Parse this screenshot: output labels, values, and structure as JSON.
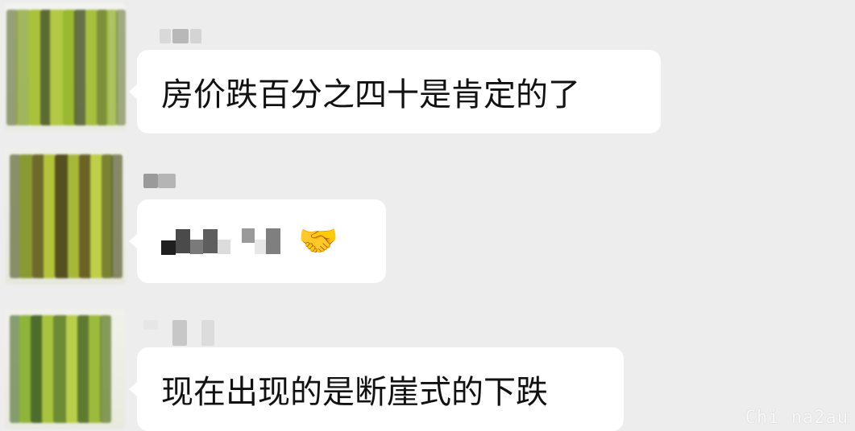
{
  "chat": {
    "messages": [
      {
        "text": "房价跌百分之四十是肯定的了"
      },
      {
        "emoji": "🤝"
      },
      {
        "text": "现在出现的是断崖式的下跌"
      }
    ]
  },
  "watermark": {
    "text": "Chi na2au"
  },
  "colors": {
    "background": "#ededed",
    "bubble": "#ffffff",
    "avatar_green": "#9ab832",
    "avatar_dark": "#4f5a2a"
  }
}
